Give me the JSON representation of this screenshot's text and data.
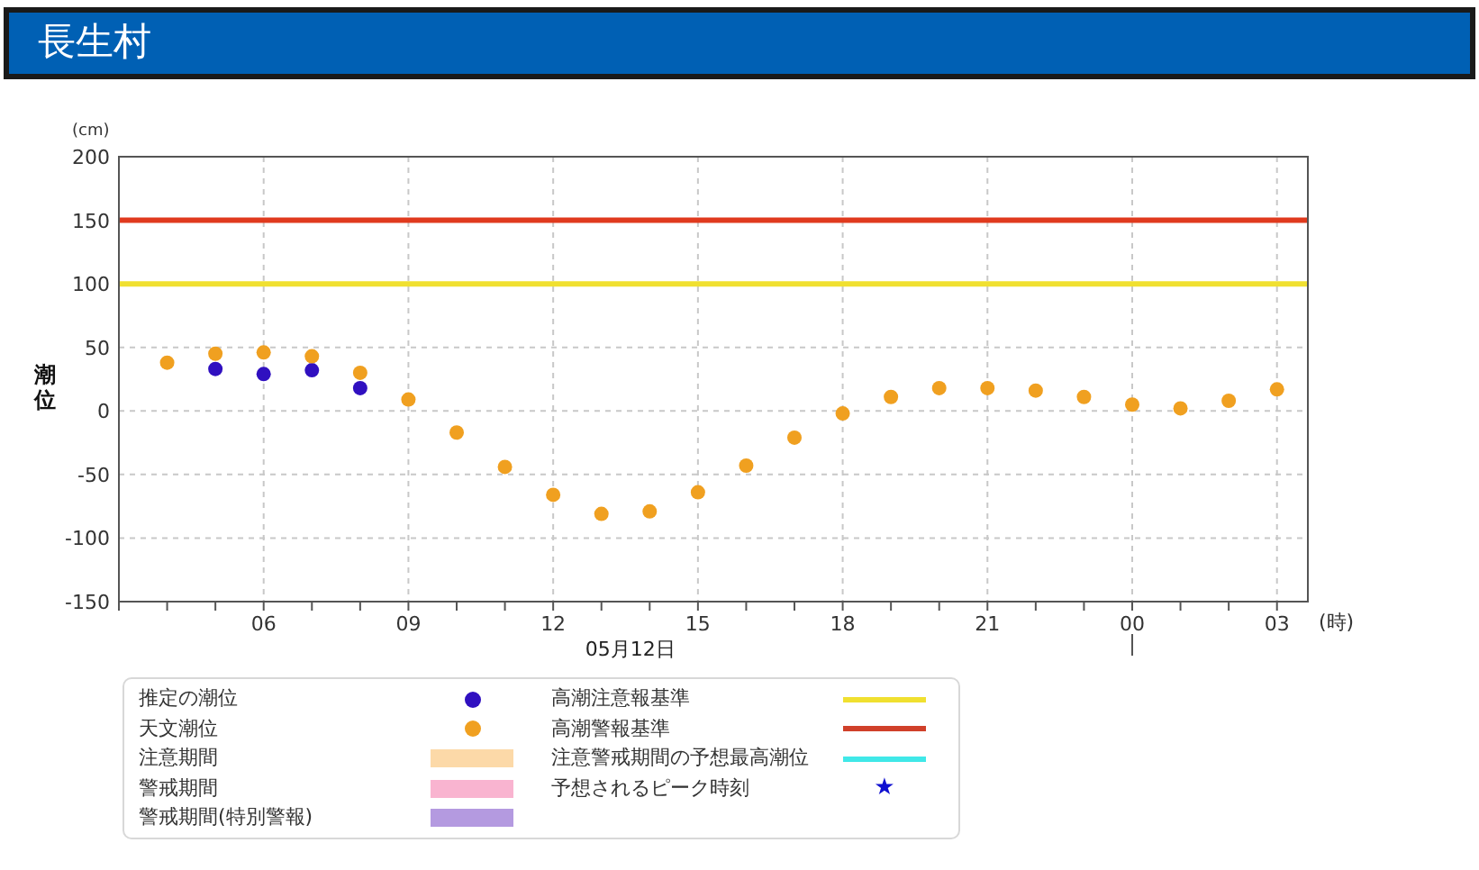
{
  "header": {
    "title": "長生村"
  },
  "axis_units": {
    "y": "(cm)",
    "x": "(時)"
  },
  "next_day_ticks": [
    "00",
    "03"
  ],
  "chart_data": {
    "type": "scatter",
    "ylabel": "潮位",
    "xlabel": "05月12日",
    "grid": true,
    "xlim": [
      3,
      27.64
    ],
    "ylim": [
      -150,
      200
    ],
    "xticks": [
      {
        "value": 6,
        "label": "06"
      },
      {
        "value": 9,
        "label": "09"
      },
      {
        "value": 12,
        "label": "12"
      },
      {
        "value": 15,
        "label": "15"
      },
      {
        "value": 18,
        "label": "18"
      },
      {
        "value": 21,
        "label": "21"
      }
    ],
    "yticks": [
      -150,
      -100,
      -50,
      0,
      50,
      100,
      150,
      200
    ],
    "series": [
      {
        "name": "推定の潮位",
        "color": "#3010c0",
        "x": [
          5,
          6,
          7,
          8
        ],
        "values": [
          33,
          29,
          32,
          18
        ]
      },
      {
        "name": "天文潮位",
        "color": "#f0a020",
        "x": [
          4,
          5,
          6,
          7,
          8,
          9,
          10,
          11,
          12,
          13,
          14,
          15,
          16,
          17,
          18,
          19,
          20,
          21,
          22,
          23,
          24,
          25,
          26,
          27
        ],
        "values": [
          38,
          45,
          46,
          43,
          30,
          9,
          -17,
          -44,
          -66,
          -81,
          -79,
          -64,
          -43,
          -21,
          -2,
          11,
          18,
          18,
          16,
          11,
          5,
          2,
          8,
          17
        ]
      }
    ],
    "ref_lines": [
      {
        "axis": "y",
        "value": 150,
        "color": "#e03a1e"
      },
      {
        "axis": "y",
        "value": 100,
        "color": "#f0e030"
      }
    ]
  },
  "legend": [
    {
      "label": "注意期間",
      "kind": "band",
      "color": "#fcd9a8"
    },
    {
      "label": "警戒期間",
      "kind": "band",
      "color": "#f9b4d0"
    },
    {
      "label": "警戒期間(特別警報)",
      "kind": "band",
      "color": "#b49ae0"
    },
    {
      "label": "高潮注意報基準",
      "kind": "line",
      "color": "#f0e030"
    },
    {
      "label": "高潮警報基準",
      "kind": "line",
      "color": "#d0402a"
    },
    {
      "label": "注意警戒期間の予想最高潮位",
      "kind": "line",
      "color": "#40e8e8"
    },
    {
      "label": "予想されるピーク時刻",
      "kind": "star",
      "color": "#1010d0",
      "symbol": "★"
    }
  ]
}
